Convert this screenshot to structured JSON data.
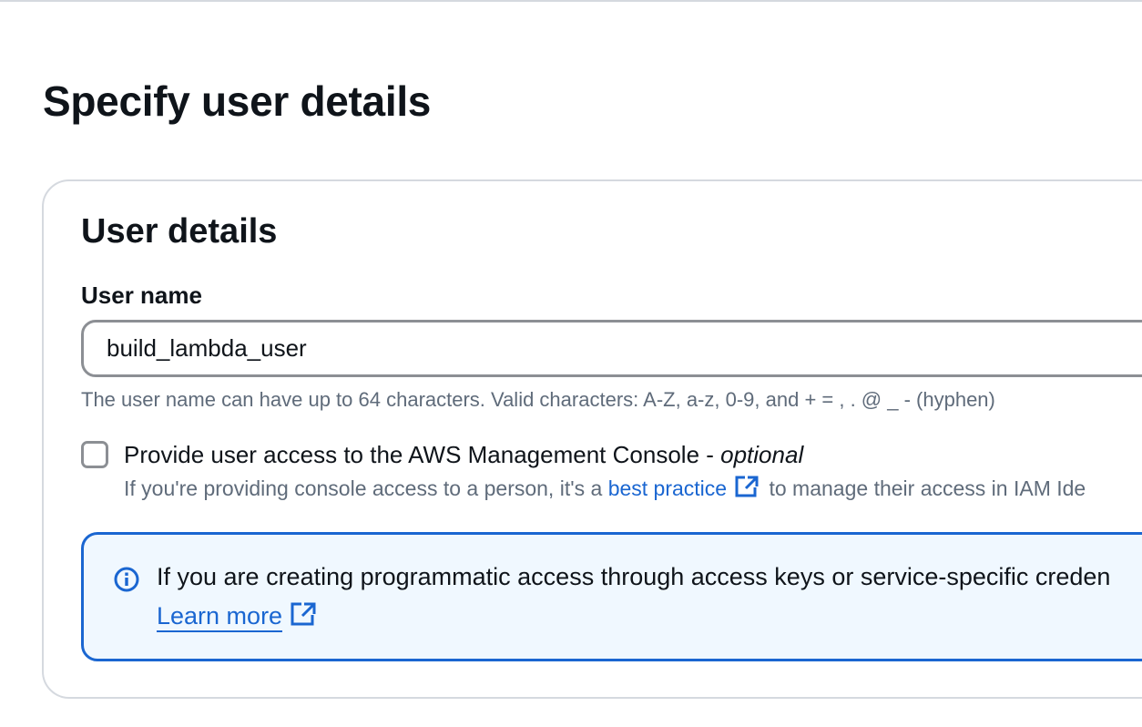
{
  "page": {
    "title": "Specify user details"
  },
  "user_details": {
    "section_title": "User details",
    "username_label": "User name",
    "username_value": "build_lambda_user",
    "username_constraint": "The user name can have up to 64 characters. Valid characters: A-Z, a-z, 0-9, and + = , . @ _ - (hyphen)",
    "console_access": {
      "checked": false,
      "label": "Provide user access to the AWS Management Console - ",
      "label_optional": "optional",
      "desc_prefix": "If you're providing console access to a person, it's a ",
      "desc_link": "best practice",
      "desc_suffix": " to manage their access in IAM Ide"
    }
  },
  "info_alert": {
    "text": "If you are creating programmatic access through access keys or service-specific creden",
    "learn_more": "Learn more"
  },
  "icons": {
    "info": "info-icon",
    "external": "external-link-icon"
  },
  "colors": {
    "link": "#1a66d1",
    "alert_border": "#1a66d1",
    "alert_bg": "#f0f8ff"
  }
}
